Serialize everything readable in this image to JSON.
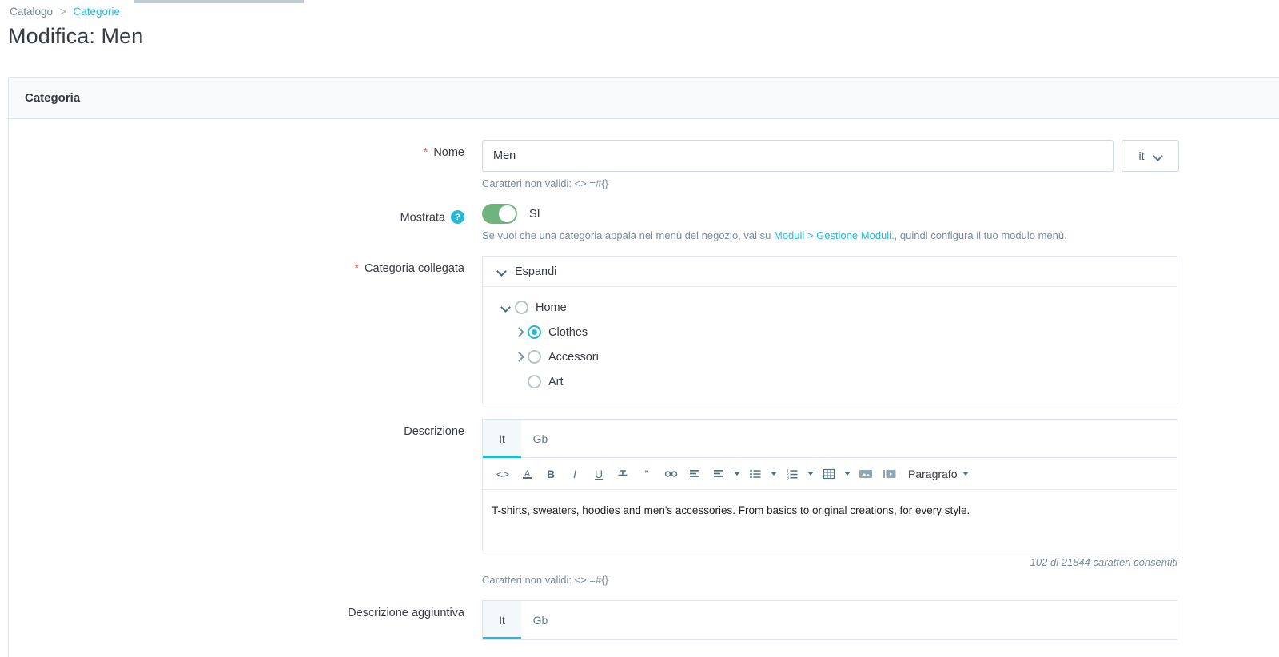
{
  "breadcrumb": {
    "root": "Catalogo",
    "separator": ">",
    "current": "Categorie"
  },
  "page_title": "Modifica: Men",
  "panel": {
    "title": "Categoria"
  },
  "fields": {
    "name": {
      "label": "Nome",
      "required_marker": "*",
      "value": "Men",
      "placeholder": "",
      "helper": "Caratteri non validi: <>;=#{}",
      "language": "it"
    },
    "displayed": {
      "label": "Mostrata",
      "help_icon": "?",
      "toggle_state": "SI",
      "helper_prefix": "Se vuoi che una categoria appaia nel menù del negozio, vai su ",
      "helper_link": "Moduli > Gestione Moduli.",
      "helper_suffix": ", quindi configura il tuo modulo menù."
    },
    "parent_category": {
      "label": "Categoria collegata",
      "required_marker": "*",
      "expand_label": "Espandi",
      "nodes": [
        {
          "label": "Home",
          "depth": 0,
          "chevron": "chevron-down",
          "selected": false
        },
        {
          "label": "Clothes",
          "depth": 1,
          "chevron": "chevron-right",
          "selected": true
        },
        {
          "label": "Accessori",
          "depth": 1,
          "chevron": "chevron-right",
          "selected": false
        },
        {
          "label": "Art",
          "depth": 1,
          "chevron": "none",
          "selected": false
        }
      ]
    },
    "description": {
      "label": "Descrizione",
      "tabs": [
        {
          "label": "It",
          "active": true
        },
        {
          "label": "Gb",
          "active": false
        }
      ],
      "toolbar": {
        "paragraph_label": "Paragrafo",
        "buttons": [
          "code-icon",
          "text-color-icon",
          "bold-icon",
          "italic-icon",
          "underline-icon",
          "strikethrough-icon",
          "blockquote-icon",
          "link-icon",
          "align-left-icon",
          "unordered-list-icon",
          "ordered-list-icon",
          "table-icon",
          "image-icon",
          "video-icon"
        ]
      },
      "content": "T-shirts, sweaters, hoodies and men's accessories. From basics to original creations, for every style.",
      "counter": "102 di 21844 caratteri consentiti",
      "helper": "Caratteri non validi: <>;=#{}"
    },
    "additional_description": {
      "label": "Descrizione aggiuntiva",
      "tabs": [
        {
          "label": "It",
          "active": true
        },
        {
          "label": "Gb",
          "active": false
        }
      ]
    }
  },
  "colors": {
    "accent": "#25b9d7",
    "toggle_on": "#6fb47f",
    "required": "#f0675f",
    "muted_text": "#7a8d97",
    "border": "#dfe4e8"
  }
}
